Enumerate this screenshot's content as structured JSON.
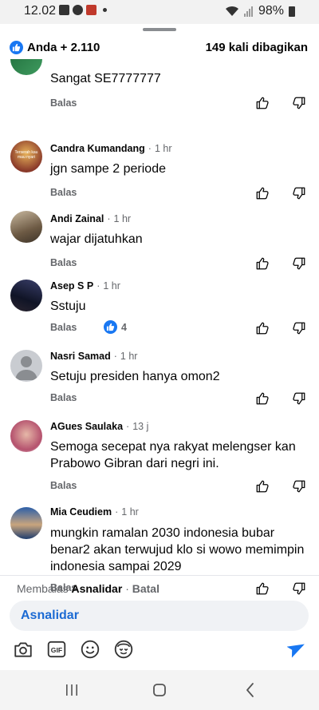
{
  "status_bar": {
    "time": "12.02",
    "battery": "98%"
  },
  "header": {
    "reactions": "Anda + 2.110",
    "shares": "149 kali dibagikan"
  },
  "comments": [
    {
      "name": "",
      "time": "",
      "text": "Sangat SE7777777",
      "reply": "Balas"
    },
    {
      "name": "Candra Kumandang",
      "time": "1 hr",
      "text": "jgn sampe 2 periode",
      "reply": "Balas",
      "avatar_text": "Terserah kau mau nyari"
    },
    {
      "name": "Andi Zainal",
      "time": "1 hr",
      "text": "wajar dijatuhkan",
      "reply": "Balas"
    },
    {
      "name": "Asep S P",
      "time": "1 hr",
      "text": "Sstuju",
      "reply": "Balas",
      "likes": "4"
    },
    {
      "name": "Nasri Samad",
      "time": "1 hr",
      "text": "Setuju presiden hanya omon2",
      "reply": "Balas"
    },
    {
      "name": "AGues Saulaka",
      "time": "13 j",
      "text": "Semoga secepat nya rakyat melengser kan Prabowo Gibran dari negri ini.",
      "reply": "Balas"
    },
    {
      "name": "Mia Ceudiem",
      "time": "1 hr",
      "text": "mungkin ramalan 2030 indonesia bubar benar2 akan terwujud klo si wowo memimpin indonesia sampai 2029",
      "reply": "Balas"
    }
  ],
  "composer": {
    "replying_prefix": "Membalas",
    "replying_to": "Asnalidar",
    "cancel": "Batal",
    "input_value": "Asnalidar"
  },
  "colors": {
    "accent": "#1877f2",
    "mention": "#1b6ad3",
    "muted": "#65676b"
  },
  "icons": [
    "camera-icon",
    "gif-icon",
    "emoji-icon",
    "avatar-sticker-icon",
    "send-icon",
    "recents-icon",
    "home-icon",
    "back-icon"
  ]
}
